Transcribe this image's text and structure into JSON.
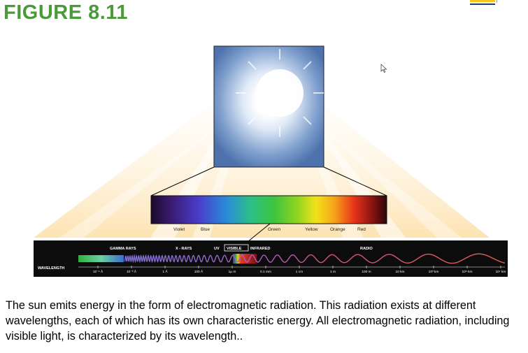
{
  "figure_title": "FIGURE 8.11",
  "colors": {
    "title_green": "#4a9a3a",
    "accent_yellow": "#f5c518",
    "accent_blue": "#1a3f8a",
    "band_background": "#0c0c0c",
    "wave_gamma": "#6a5acd",
    "wave_radio": "#e05050"
  },
  "icons": {
    "cursor": "mouse-pointer-icon",
    "sun": "sun-icon"
  },
  "visible_spectrum": {
    "labels": [
      "Violet",
      "Blue",
      "Green",
      "Yellow",
      "Orange",
      "Red"
    ]
  },
  "em_spectrum": {
    "regions": [
      "GAMMA RAYS",
      "X - RAYS",
      "UV",
      "VISIBLE",
      "INFRARED",
      "RADIO"
    ],
    "axis_label": "WAVELENGTH",
    "ticks": [
      "10⁻⁶ Å",
      "10⁻² Å",
      "1 Å",
      "100 Å",
      "1μ m",
      "0.1 mm",
      "1 cm",
      "1 m",
      "100 m",
      "10 km",
      "10³ km",
      "10⁵ km",
      "10⁷ km"
    ]
  },
  "caption": "The sun emits energy in the form of electromagnetic radiation. This radiation exists at different wavelengths, each of which has its own characteristic energy. All electromagnetic radiation, including visible light, is characterized by its wavelength.."
}
